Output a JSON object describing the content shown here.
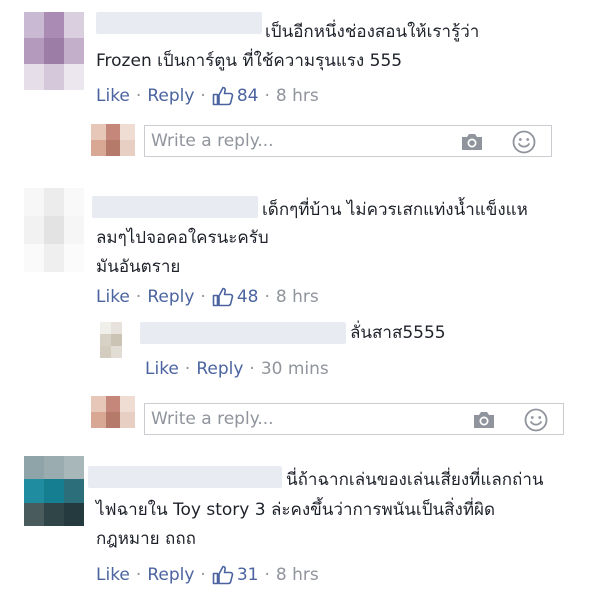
{
  "colors": {
    "link": "#4b64a0",
    "meta": "#90949c",
    "text": "#1d2129",
    "border": "#c9ccd1"
  },
  "comments": [
    {
      "text_lines": [
        "เป็นอีกหนึ่งช่องสอนให้เรารู้ว่า",
        "Frozen เป็นการ์ตูน ที่ใช้ความรุนแรง 555"
      ],
      "like": "Like",
      "reply": "Reply",
      "like_icon": "thumbs-up-icon",
      "count": "84",
      "time": "8 hrs"
    },
    {
      "text_lines": [
        "เด็กๆที่บ้าน ไม่ควรเสกแท่งน้ำแข็งแห",
        "ลมๆไปจอคอใครนะครับ",
        "มันอันตราย"
      ],
      "like": "Like",
      "reply": "Reply",
      "like_icon": "thumbs-up-icon",
      "count": "48",
      "time": "8 hrs"
    },
    {
      "text_lines": [
        "นี่ถ้าฉากเล่นของเล่นเสี่ยงที่แลกถ่าน",
        "ไฟฉายใน Toy story 3 ล่ะคงขึ้นว่าการพนันเป็นสิ่งที่ผิด",
        "กฎหมาย ถถถ"
      ],
      "like": "Like",
      "reply": "Reply",
      "like_icon": "thumbs-up-icon",
      "count": "31",
      "time": "8 hrs"
    }
  ],
  "nested_reply": {
    "text": "ลั่นสาส5555",
    "like": "Like",
    "reply": "Reply",
    "time": "30 mins"
  },
  "reply_boxes": [
    {
      "placeholder": "Write a reply...",
      "camera_icon": "camera-icon",
      "emoji_icon": "smiley-icon"
    },
    {
      "placeholder": "Write a reply...",
      "camera_icon": "camera-icon",
      "emoji_icon": "smiley-icon"
    }
  ],
  "separator": "·"
}
